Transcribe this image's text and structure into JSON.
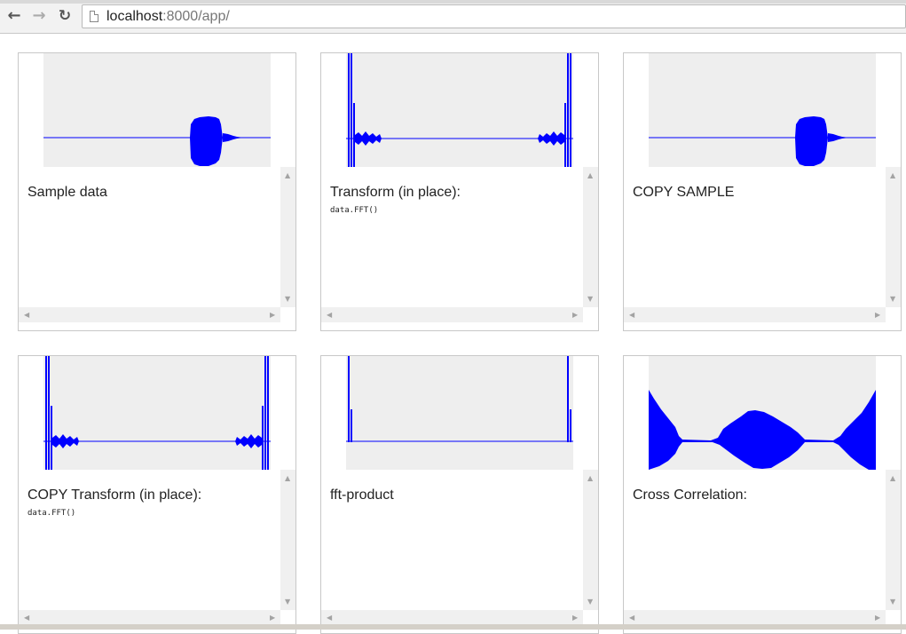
{
  "browser": {
    "back_icon": "←",
    "forward_icon": "→",
    "reload_icon": "↻",
    "url_host": "localhost",
    "url_rest": ":8000/app/"
  },
  "panels": [
    {
      "title": "Sample data",
      "code": ""
    },
    {
      "title": "Transform (in place):",
      "code": "data.FFT()"
    },
    {
      "title": "COPY SAMPLE",
      "code": ""
    },
    {
      "title": "COPY Transform (in place):",
      "code": "data.FFT()"
    },
    {
      "title": "fft-product",
      "code": ""
    },
    {
      "title": "Cross Correlation:",
      "code": ""
    }
  ],
  "scroll_arrows": {
    "up": "▲",
    "down": "▼",
    "left": "◀",
    "right": "▶"
  },
  "colors": {
    "signal": "#0000ff",
    "plot_bg": "#eeeeee"
  }
}
